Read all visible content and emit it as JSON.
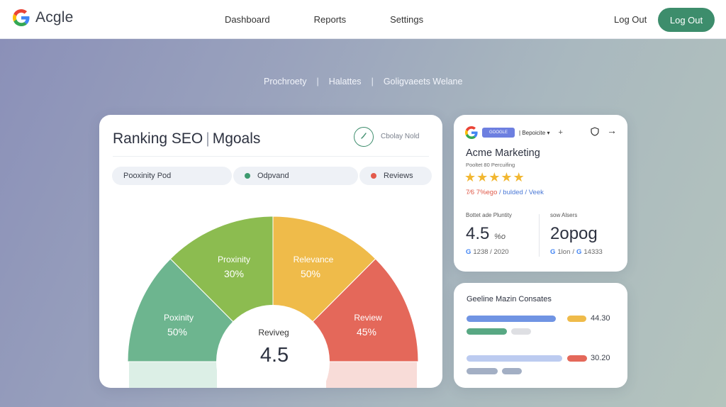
{
  "nav": {
    "brand": "Acgle",
    "links": [
      "Dashboard",
      "Reports",
      "Settings"
    ],
    "logout_link": "Log Out",
    "logout_button": "Log Out"
  },
  "subnav": [
    "Prochroety",
    "Halattes",
    "Goligvaeets Welane"
  ],
  "main": {
    "title_a": "Ranking SEO",
    "title_b": "Mgoals",
    "clock_label": "Cbolay  Nold",
    "pills": [
      {
        "label": "Pooxinity Pod",
        "dot": ""
      },
      {
        "label": "Odpvand",
        "dot": "#3d9a6f"
      },
      {
        "label": "Reviews",
        "dot": "#e35a4c"
      }
    ],
    "segments": [
      {
        "name": "Poxinity",
        "value": "50%",
        "color": "#6db58f"
      },
      {
        "name": "Proxinity",
        "value": "30%",
        "color": "#8cbc50"
      },
      {
        "name": "Relevance",
        "value": "50%",
        "color": "#efbb4a"
      },
      {
        "name": "Review",
        "value": "45%",
        "color": "#e4685a"
      }
    ],
    "center_label": "Reviveg",
    "center_value": "4.5"
  },
  "business": {
    "chip": "GOOGLE",
    "select": "Bepoicite",
    "name": "Acme Marketing",
    "subtitle": "Pooltet 80 Percuifing",
    "stars": 5,
    "link_red": "7⁄6 7%ego",
    "link_sep1": "/",
    "link_blue1": "bulded",
    "link_sep2": "/",
    "link_blue2": "Veek",
    "left_stat": {
      "label": "Bottet ade Pluntity",
      "value": "4.5",
      "unit": "%o",
      "foot": "1238 / 2020"
    },
    "right_stat": {
      "label": "sow Alsers",
      "value": "2opog",
      "foot_a": "1lon",
      "foot_b": "14333"
    }
  },
  "bars": {
    "title": "Geeline Mazin Consates",
    "value1": "44.30",
    "value2": "30.20"
  },
  "colors": {
    "accent_green": "#3d8d6c",
    "google_blue": "#4285f4",
    "google_red": "#ea4335",
    "google_yellow": "#fbbc05",
    "google_green": "#34a853"
  }
}
